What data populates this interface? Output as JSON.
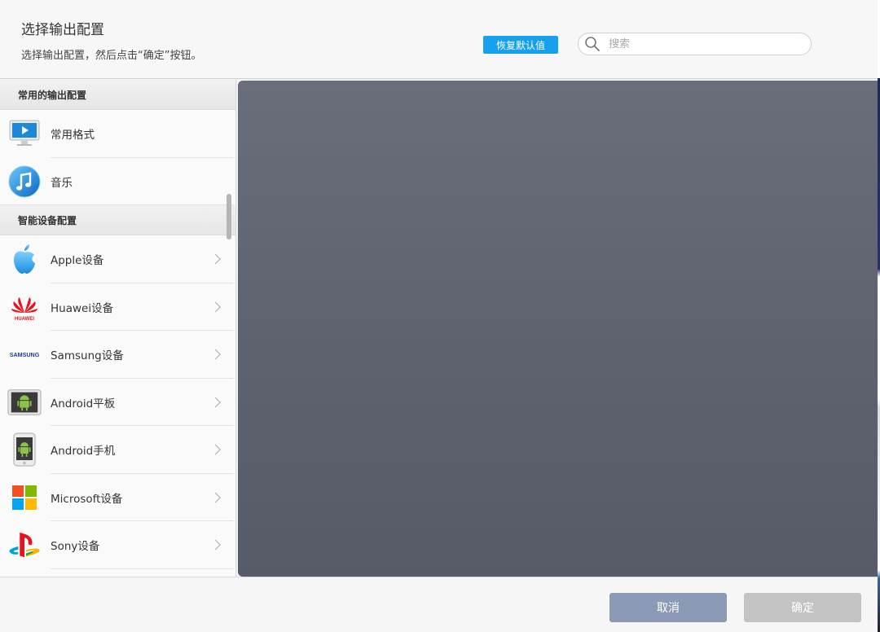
{
  "header": {
    "title": "选择输出配置",
    "subtitle": "选择输出配置，然后点击“确定”按钮。",
    "reset_label": "恢复默认值",
    "search_placeholder": "搜索"
  },
  "sidebar": {
    "sections": [
      {
        "label": "常用的输出配置"
      },
      {
        "label": "智能设备配置"
      }
    ],
    "common_items": [
      {
        "label": "常用格式",
        "icon": "monitor-icon"
      },
      {
        "label": "音乐",
        "icon": "music-note-icon"
      }
    ],
    "device_items": [
      {
        "label": "Apple设备",
        "icon": "apple-logo-icon"
      },
      {
        "label": "Huawei设备",
        "icon": "huawei-logo-icon",
        "logo_text": "HUAWEI"
      },
      {
        "label": "Samsung设备",
        "icon": "samsung-logo-icon",
        "logo_text": "SAMSUNG"
      },
      {
        "label": "Android平板",
        "icon": "android-tablet-icon"
      },
      {
        "label": "Android手机",
        "icon": "android-phone-icon"
      },
      {
        "label": "Microsoft设备",
        "icon": "microsoft-logo-icon"
      },
      {
        "label": "Sony设备",
        "icon": "playstation-logo-icon"
      }
    ]
  },
  "footer": {
    "cancel_label": "取消",
    "ok_label": "确定"
  },
  "colors": {
    "accent": "#18a0f0",
    "cancel_button": "#8c9bb5",
    "ok_button_disabled": "#c3c3c3",
    "preview_background": "#5f636f"
  }
}
